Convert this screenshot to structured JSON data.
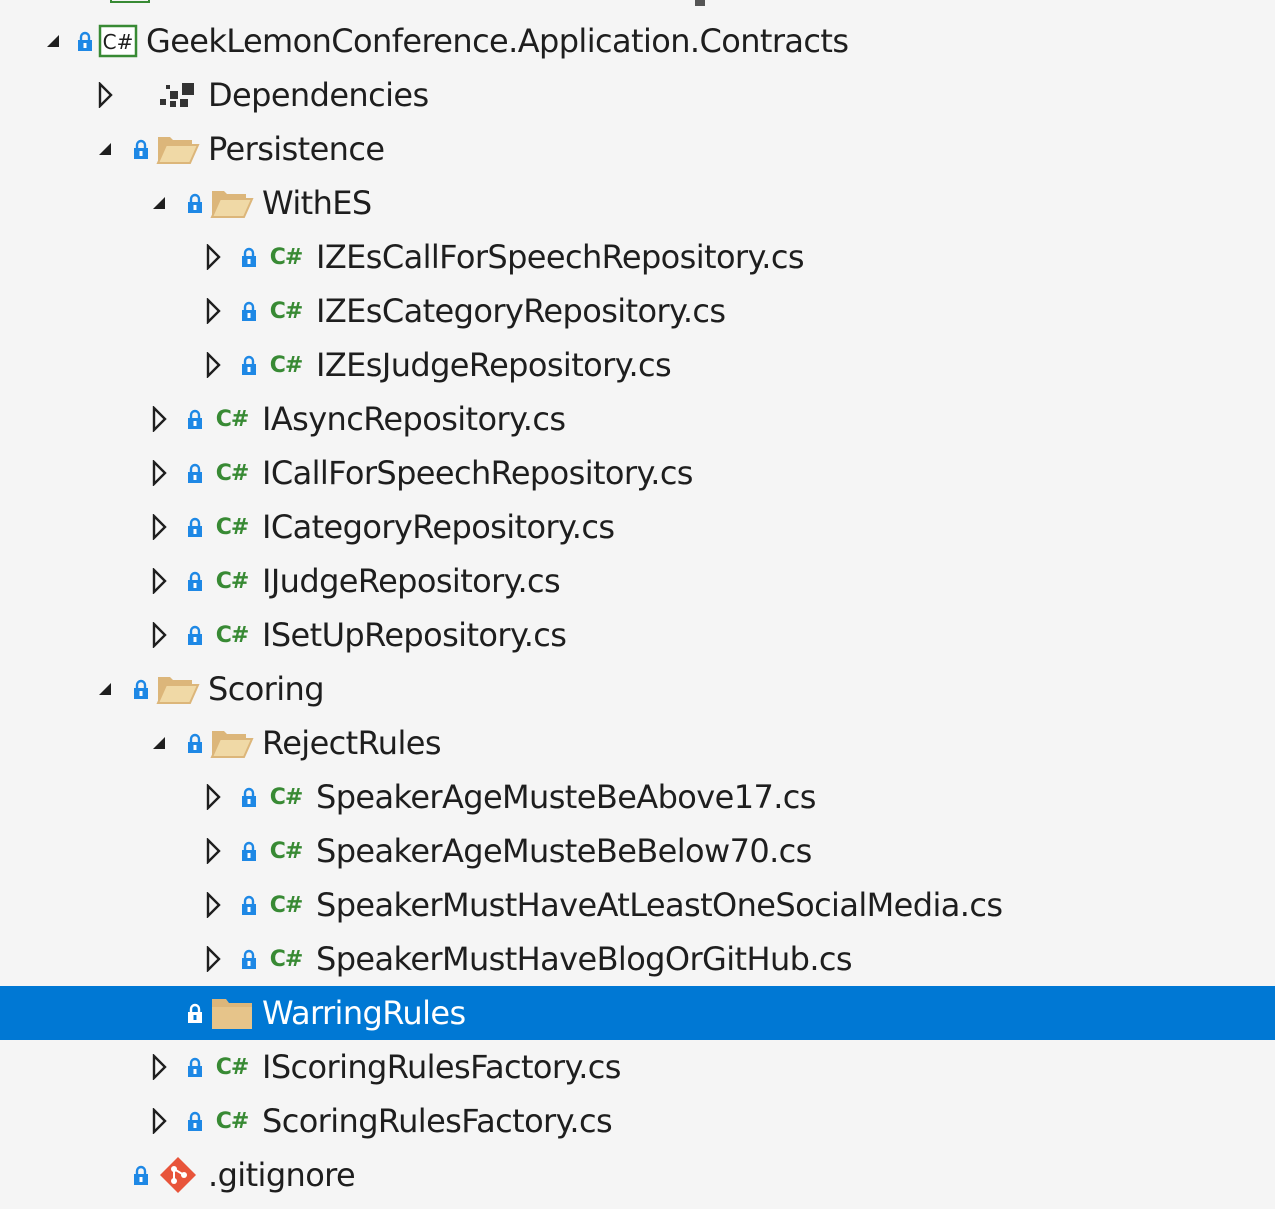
{
  "solution_explorer": {
    "project": {
      "label": "GeekLemonConference.Application.Contracts",
      "icon": "csharp-project-icon",
      "expanded": true,
      "children": [
        {
          "label": "Dependencies",
          "icon": "dependencies-icon",
          "expanded": false
        },
        {
          "label": "Persistence",
          "icon": "folder-open-icon",
          "expanded": true
        },
        {
          "label": "WithES",
          "icon": "folder-open-icon",
          "expanded": true
        },
        {
          "label": "IZEsCallForSpeechRepository.cs",
          "icon": "csharp-file-icon",
          "expanded": false
        },
        {
          "label": "IZEsCategoryRepository.cs",
          "icon": "csharp-file-icon",
          "expanded": false
        },
        {
          "label": "IZEsJudgeRepository.cs",
          "icon": "csharp-file-icon",
          "expanded": false
        },
        {
          "label": "IAsyncRepository.cs",
          "icon": "csharp-file-icon",
          "expanded": false
        },
        {
          "label": "ICallForSpeechRepository.cs",
          "icon": "csharp-file-icon",
          "expanded": false
        },
        {
          "label": "ICategoryRepository.cs",
          "icon": "csharp-file-icon",
          "expanded": false
        },
        {
          "label": "IJudgeRepository.cs",
          "icon": "csharp-file-icon",
          "expanded": false
        },
        {
          "label": "ISetUpRepository.cs",
          "icon": "csharp-file-icon",
          "expanded": false
        },
        {
          "label": "Scoring",
          "icon": "folder-open-icon",
          "expanded": true
        },
        {
          "label": "RejectRules",
          "icon": "folder-open-icon",
          "expanded": true
        },
        {
          "label": "SpeakerAgeMusteBeAbove17.cs",
          "icon": "csharp-file-icon",
          "expanded": false
        },
        {
          "label": "SpeakerAgeMusteBeBelow70.cs",
          "icon": "csharp-file-icon",
          "expanded": false
        },
        {
          "label": "SpeakerMustHaveAtLeastOneSocialMedia.cs",
          "icon": "csharp-file-icon",
          "expanded": false
        },
        {
          "label": "SpeakerMustHaveBlogOrGitHub.cs",
          "icon": "csharp-file-icon",
          "expanded": false
        },
        {
          "label": "WarringRules",
          "icon": "folder-closed-icon",
          "expanded": false,
          "selected": true
        },
        {
          "label": "IScoringRulesFactory.cs",
          "icon": "csharp-file-icon",
          "expanded": false
        },
        {
          "label": "ScoringRulesFactory.cs",
          "icon": "csharp-file-icon",
          "expanded": false
        },
        {
          "label": ".gitignore",
          "icon": "git-icon",
          "expanded": false
        }
      ]
    },
    "csharp_badge": "C#",
    "colors": {
      "selection": "#0078d4",
      "background": "#f5f5f5",
      "csharp_green": "#388a34",
      "lock_blue": "#1e88e5",
      "folder": "#dcb67a",
      "git_red": "#e8543a"
    }
  }
}
